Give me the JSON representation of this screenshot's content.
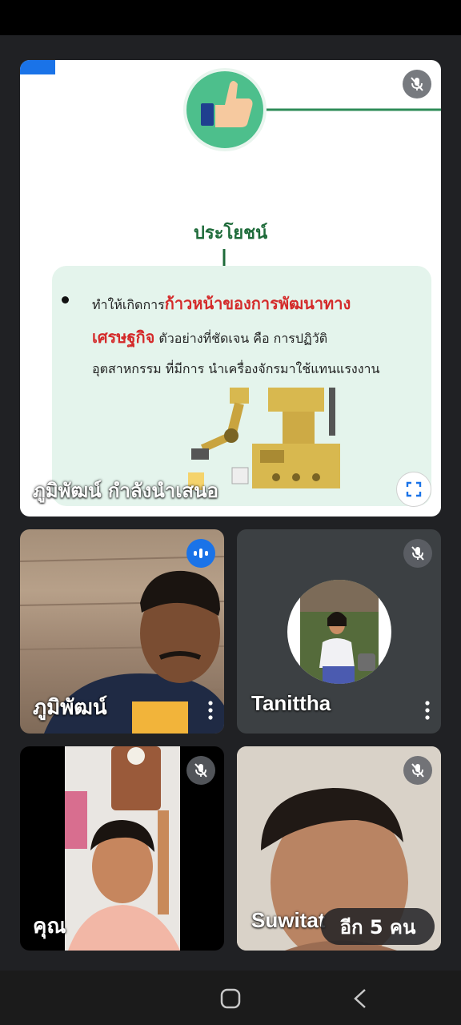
{
  "presentation": {
    "slide": {
      "title": "ประโยชน์",
      "bullet_line1_normal": "ทำให้เกิดการ",
      "bullet_line1_red": "ก้าวหน้าของการพัฒนาทาง",
      "bullet_line2_red": "เศรษฐกิจ",
      "bullet_line2_normal": " ตัวอย่างที่ชัดเจน คือ การปฏิวัติ",
      "bullet_line3": "อุตสาหกรรม ที่มีการ  นำเครื่องจักรมาใช้แทนแรงงาน",
      "accent_green": "#1e6b3a",
      "accent_red": "#d42a2a"
    },
    "label": "ภูมิพัฒน์ กำลังนำเสนอ",
    "mic_icon": "mic-off-icon",
    "fullscreen_icon": "fullscreen-icon"
  },
  "participants": [
    {
      "name": "ภูมิพัฒน์",
      "status": "speaking",
      "icon": "audio-wave-icon"
    },
    {
      "name": "Tanittha",
      "status": "muted",
      "icon": "mic-off-icon"
    },
    {
      "name": "คุณ",
      "status": "muted",
      "icon": "mic-off-icon"
    },
    {
      "name": "Suwitat",
      "status": "muted",
      "icon": "mic-off-icon"
    }
  ],
  "more_participants": "อีก 5 คน",
  "colors": {
    "background": "#202124",
    "speaking_blue": "#1a73e8"
  },
  "nav": {
    "home_icon": "home-icon",
    "back_icon": "back-icon"
  }
}
